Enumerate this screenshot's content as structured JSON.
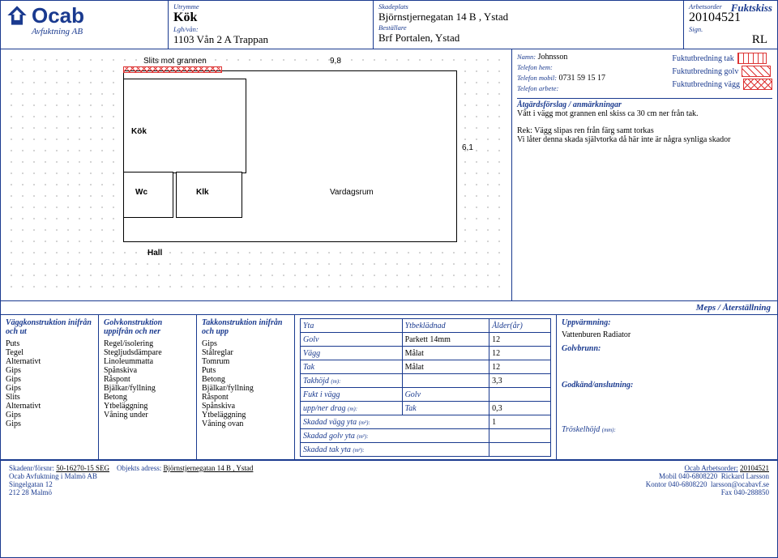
{
  "doc_title": "Fuktskiss",
  "logo_text": "Ocab",
  "logo_sub": "Avfuktning AB",
  "header": {
    "utrymme_lbl": "Utrymme",
    "utrymme": "Kök",
    "lgh_lbl": "Lgh/vån:",
    "lgh": "1103 Vån 2 A Trappan",
    "skadeplats_lbl": "Skadeplats",
    "skadeplats": "Björnstjernegatan 14 B , Ystad",
    "bestallare_lbl": "Beställare",
    "bestallare": "Brf Portalen, Ystad",
    "arbetsorder_lbl": "Arbetsorder",
    "arbetsorder": "20104521",
    "sign_lbl": "Sign.",
    "sign": "RL"
  },
  "contact": {
    "namn_lbl": "Namn:",
    "namn": "Johnsson",
    "tel_hem_lbl": "Telefon hem:",
    "tel_hem": "",
    "tel_mob_lbl": "Telefon mobil:",
    "tel_mob": "0731 59 15 17",
    "tel_arb_lbl": "Telefon arbete:",
    "tel_arb": ""
  },
  "atgard_head": "Åtgärdsförslag / anmärkningar",
  "atgard_1": "Vått i vägg mot grannen enl skiss ca 30 cm ner från tak.",
  "atgard_2": "Rek: Vägg slipas ren från färg samt torkas",
  "atgard_3": "Vi låter denna skada självtorka då här inte är några synliga skador",
  "legend": {
    "tak": "Fuktutbredning tak",
    "golv": "Fuktutbredning golv",
    "vagg": "Fuktutbredning vägg"
  },
  "meps": "Meps / Återställning",
  "vagg_head": "Väggkonstruktion inifrån och ut",
  "vagg_items": [
    "Puts",
    "Tegel",
    "Alternativt",
    "Gips",
    "Gips",
    "Gips",
    "Slits",
    "Alternativt",
    "Gips",
    "Gips"
  ],
  "golv_head": "Golvkonstruktion uppifrån och ner",
  "golv_items": [
    "Regel/isolering",
    "Stegljudsdämpare",
    "Linoleummatta",
    "Spånskiva",
    "Råspont",
    "Bjälkar/fyllning",
    "Betong",
    "Ytbeläggning",
    "Våning under"
  ],
  "tak_head": "Takkonstruktion inifrån och upp",
  "tak_items": [
    "Gips",
    "Stålreglar",
    "Tomrum",
    "Puts",
    "Betong",
    "Bjälkar/fyllning",
    "Råspont",
    "Spånskiva",
    "Ytbeläggning",
    "Våning ovan"
  ],
  "yta": {
    "h1": "Yta",
    "h2": "Ytbeklädnad",
    "h3": "Ålder(år)",
    "golv": "Golv",
    "golv_b": "Parkett 14mm",
    "golv_a": "12",
    "vagg": "Vägg",
    "vagg_b": "Målat",
    "vagg_a": "12",
    "tak": "Tak",
    "tak_b": "Målat",
    "tak_a": "12",
    "takhojd": "Takhöjd",
    "takhojd_v": "3,3",
    "fukt": "Fukt i vägg",
    "golvcol": "Golv",
    "upp": "upp/ner drag",
    "takcol": "Tak",
    "upp_v": "0,3",
    "skv": "Skadad vägg yta",
    "skv_v": "1",
    "skg": "Skadad golv yta",
    "skt": "Skadad tak yta",
    "m": "(m):",
    "m2": "(m²):"
  },
  "right": {
    "uppv": "Uppvärmning:",
    "uppv_v": "Vattenburen Radiator",
    "golvb": "Golvbrunn:",
    "god": "Godkänd/anslutning:",
    "tros": "Tröskelhöjd",
    "mm": "(mm):"
  },
  "footer": {
    "skadenr_lbl": "Skadenr/försnr:",
    "skadenr": "50-16270-15 SEG",
    "obj_lbl": "Objekts adress:",
    "obj": "Björnstjernegatan 14 B , Ystad",
    "arb_lbl": "Ocab Arbetsorder:",
    "arb": "20104521",
    "company": "Ocab Avfuktning i Malmö AB",
    "addr1": "Singelgatan 12",
    "addr2": "212 28 Malmö",
    "mob_lbl": "Mobil",
    "mob": "040-6808220",
    "name": "Rickard Larsson",
    "kontor_lbl": "Kontor",
    "kontor": "040-6808220",
    "email": "larsson@ocabavf.se",
    "fax_lbl": "Fax",
    "fax": "040-288850"
  },
  "plan": {
    "dim_w": "9,8",
    "dim_h": "6,1",
    "kok": "Kök",
    "wc": "Wc",
    "klk": "Klk",
    "vard": "Vardagsrum",
    "hall": "Hall",
    "slits": "Slits mot grannen"
  }
}
